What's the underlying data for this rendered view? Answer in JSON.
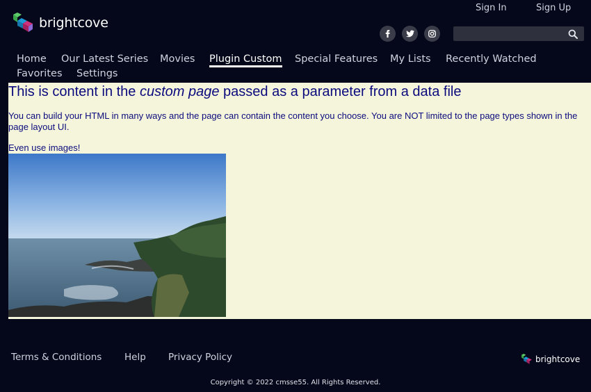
{
  "brand": {
    "name": "brightcove"
  },
  "auth": {
    "sign_in": "Sign In",
    "sign_up": "Sign Up"
  },
  "social": [
    "facebook-icon",
    "twitter-icon",
    "instagram-icon"
  ],
  "search": {
    "placeholder": "",
    "value": ""
  },
  "nav": {
    "items": [
      {
        "label": "Home"
      },
      {
        "label": "Our Latest Series"
      },
      {
        "label": "Movies"
      },
      {
        "label": "Plugin Custom",
        "active": true
      },
      {
        "label": "Special Features"
      },
      {
        "label": "My Lists"
      },
      {
        "label": "Recently Watched"
      },
      {
        "label": "Favorites"
      },
      {
        "label": "Settings"
      }
    ]
  },
  "main": {
    "heading_pre": "This is content in the ",
    "heading_em": "custom page",
    "heading_post": " passed as a parameter from a data file",
    "para1": "You can build your HTML in many ways and the page can contain the content you choose. You are NOT limited to the page types shown in the page layout UI.",
    "para2": "Even use images!"
  },
  "footer": {
    "links": [
      {
        "label": "Terms & Conditions"
      },
      {
        "label": "Help"
      },
      {
        "label": "Privacy Policy"
      }
    ],
    "copyright": "Copyright © 2022 cmsse55. All Rights Reserved.",
    "brand": "brightcove"
  },
  "colors": {
    "background": "#05081a",
    "content_bg": "#f5f5dc",
    "content_text": "#0b0b7d",
    "logo_green": "#5ecb6a",
    "logo_blue": "#1e9ad6",
    "logo_magenta": "#d1317a"
  }
}
